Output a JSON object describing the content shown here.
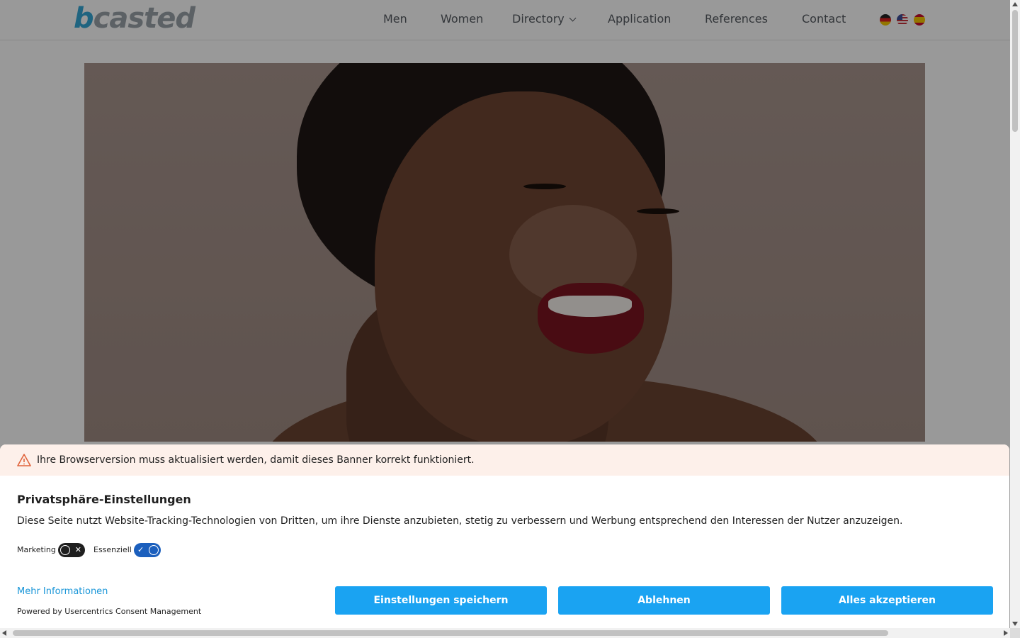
{
  "logo": {
    "brand_part": "b",
    "rest": "casted"
  },
  "nav": {
    "items": [
      "Men",
      "Women",
      "Directory",
      "Application",
      "References",
      "Contact"
    ],
    "languages": [
      "flag-de-icon",
      "flag-us-icon",
      "flag-es-icon"
    ]
  },
  "consent": {
    "warning": "Ihre Browserversion muss aktualisiert werden, damit dieses Banner korrekt funktioniert.",
    "title": "Privatsphäre-Einstellungen",
    "description": "Diese Seite nutzt Website-Tracking-Technologien von Dritten, um ihre Dienste anzubieten, stetig zu verbessern und Werbung entsprechend den Interessen der Nutzer anzuzeigen.",
    "toggles": [
      {
        "label": "Marketing",
        "state": "off"
      },
      {
        "label": "Essenziell",
        "state": "on"
      }
    ],
    "more_info": "Mehr Informationen",
    "powered_by": "Powered by Usercentrics Consent Management",
    "buttons": {
      "save": "Einstellungen speichern",
      "decline": "Ablehnen",
      "accept": "Alles akzeptieren"
    },
    "colors": {
      "button": "#1aa3f2",
      "warning_bg": "#fdf0ea",
      "link": "#1a96d8",
      "toggle_on": "#1b5fbd"
    }
  }
}
